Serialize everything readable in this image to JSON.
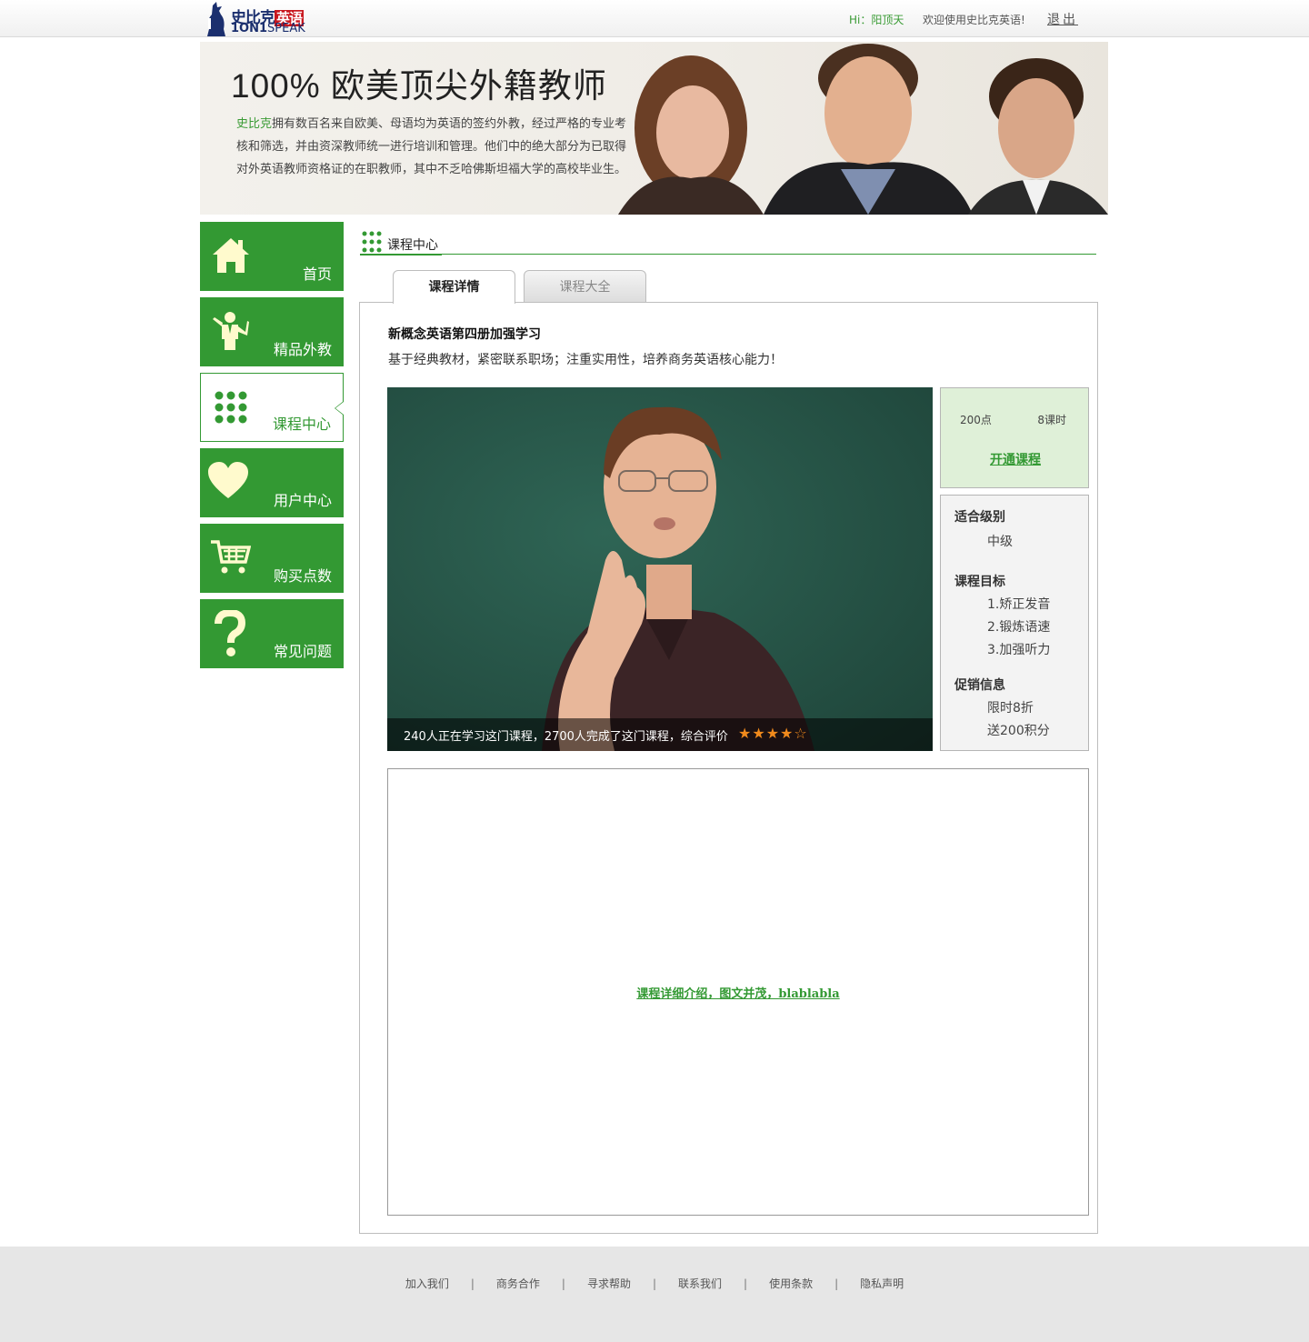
{
  "header": {
    "logo_cn": "史比克",
    "logo_cn_tag": "英语",
    "logo_en_bold": "1ON1",
    "logo_en": "SPEAK",
    "greeting": "Hi：阳顶天",
    "welcome": "欢迎使用史比克英语!",
    "logout": "退出"
  },
  "banner": {
    "title": "100% 欧美顶尖外籍教师",
    "desc_highlight": "史比克",
    "desc": "拥有数百名来自欧美、母语均为英语的签约外教，经过严格的专业考核和筛选，并由资深教师统一进行培训和管理。他们中的绝大部分为已取得对外英语教师资格证的在职教师，其中不乏哈佛斯坦福大学的高校毕业生。"
  },
  "sidebar": {
    "items": [
      {
        "label": "首页",
        "icon": "home-icon"
      },
      {
        "label": "精品外教",
        "icon": "teacher-icon"
      },
      {
        "label": "课程中心",
        "icon": "dots-grid-icon",
        "active": true
      },
      {
        "label": "用户中心",
        "icon": "heart-icon"
      },
      {
        "label": "购买点数",
        "icon": "cart-icon"
      },
      {
        "label": "常见问题",
        "icon": "question-icon"
      }
    ]
  },
  "section": {
    "title": "课程中心"
  },
  "tabs": [
    {
      "label": "课程详情",
      "active": true
    },
    {
      "label": "课程大全",
      "active": false
    }
  ],
  "course": {
    "title": "新概念英语第四册加强学习",
    "subtitle": "基于经典教材，紧密联系职场；注重实用性，培养商务英语核心能力！",
    "caption": "240人正在学习这门课程，2700人完成了这门课程，综合评价",
    "rating": 4,
    "rating_max": 5,
    "points": "200点",
    "hours": "8课时",
    "open_label": "开通课程",
    "level_label": "适合级别",
    "level": "中级",
    "goals_label": "课程目标",
    "goals": [
      "1.矫正发音",
      "2.锻炼语速",
      "3.加强听力"
    ],
    "promo_label": "促销信息",
    "promos": [
      "限时8折",
      "送200积分"
    ],
    "detail_text": "课程详细介绍，图文并茂，blablabla"
  },
  "footer": {
    "links": [
      "加入我们",
      "商务合作",
      "寻求帮助",
      "联系我们",
      "使用条款",
      "隐私声明"
    ]
  },
  "colors": {
    "brand_green": "#339933",
    "star_orange": "#f08a1c",
    "price_bg": "#dff0d8"
  }
}
